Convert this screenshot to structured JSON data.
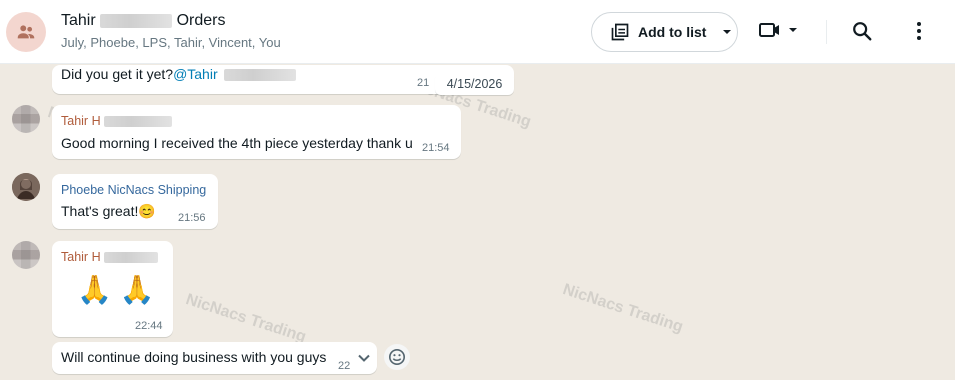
{
  "header": {
    "title_prefix": "Tahir",
    "title_suffix": "Orders",
    "participants": "July, Phoebe, LPS, Tahir, Vincent, You",
    "add_to_list_label": "Add to list",
    "icons": [
      "group-icon",
      "add-to-list-icon",
      "caret-down-icon",
      "video-call-icon",
      "search-icon",
      "more-vert-icon"
    ]
  },
  "watermark": "NicNacs Trading",
  "date_chip": "4/15/2026",
  "messages": [
    {
      "text_prefix": "Did you get it yet?",
      "mention": "@Tahir",
      "time": "21"
    },
    {
      "sender": "Tahir H",
      "text": "Good morning I received the 4th piece yesterday thank u",
      "time": "21:54"
    },
    {
      "sender": "Phoebe NicNacs Shipping",
      "text": "That's great!",
      "emoji": "😊",
      "time": "21:56"
    },
    {
      "sender": "Tahir H",
      "emoji_text": "🙏 🙏",
      "time": "22:44"
    },
    {
      "text": "Will continue doing business with you guys",
      "time": "22"
    }
  ],
  "colors": {
    "background": "#efeae2",
    "bubble": "#ffffff",
    "sender_tahir": "#b05c3b",
    "sender_phoebe": "#35689d",
    "avatar_group": "#f3d6cf",
    "mention": "#027eb5"
  }
}
